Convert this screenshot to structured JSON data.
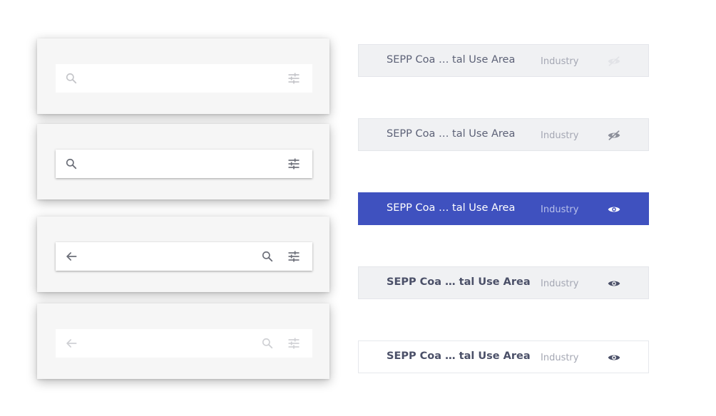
{
  "search_bars": [
    {
      "state": "default",
      "icons": [
        "search-icon",
        "tune-icon"
      ]
    },
    {
      "state": "raised",
      "icons": [
        "search-icon",
        "tune-icon"
      ]
    },
    {
      "state": "raised",
      "icons": [
        "arrow-back-icon",
        "search-icon",
        "tune-icon"
      ]
    },
    {
      "state": "disabled",
      "icons": [
        "arrow-back-icon",
        "search-icon",
        "tune-icon"
      ]
    }
  ],
  "layer_rows": [
    {
      "title": "SEPP Coa … tal Use Area",
      "tag": "Industry",
      "visibility_icon": "eye-off-icon",
      "state": "disabled"
    },
    {
      "title": "SEPP Coa … tal Use Area",
      "tag": "Industry",
      "visibility_icon": "eye-off-icon",
      "state": "hidden"
    },
    {
      "title": "SEPP Coa … tal Use Area",
      "tag": "Industry",
      "visibility_icon": "eye-icon",
      "state": "selected"
    },
    {
      "title": "SEPP Coa … tal Use Area",
      "tag": "Industry",
      "visibility_icon": "eye-icon",
      "state": "hover"
    },
    {
      "title": "SEPP Coa … tal Use Area",
      "tag": "Industry",
      "visibility_icon": "eye-icon",
      "state": "default"
    }
  ],
  "colors": {
    "accent": "#3f51bf",
    "row_bg": "#f0f1f3",
    "card_bg": "#f6f6f6",
    "icon": "#6b6e78"
  }
}
